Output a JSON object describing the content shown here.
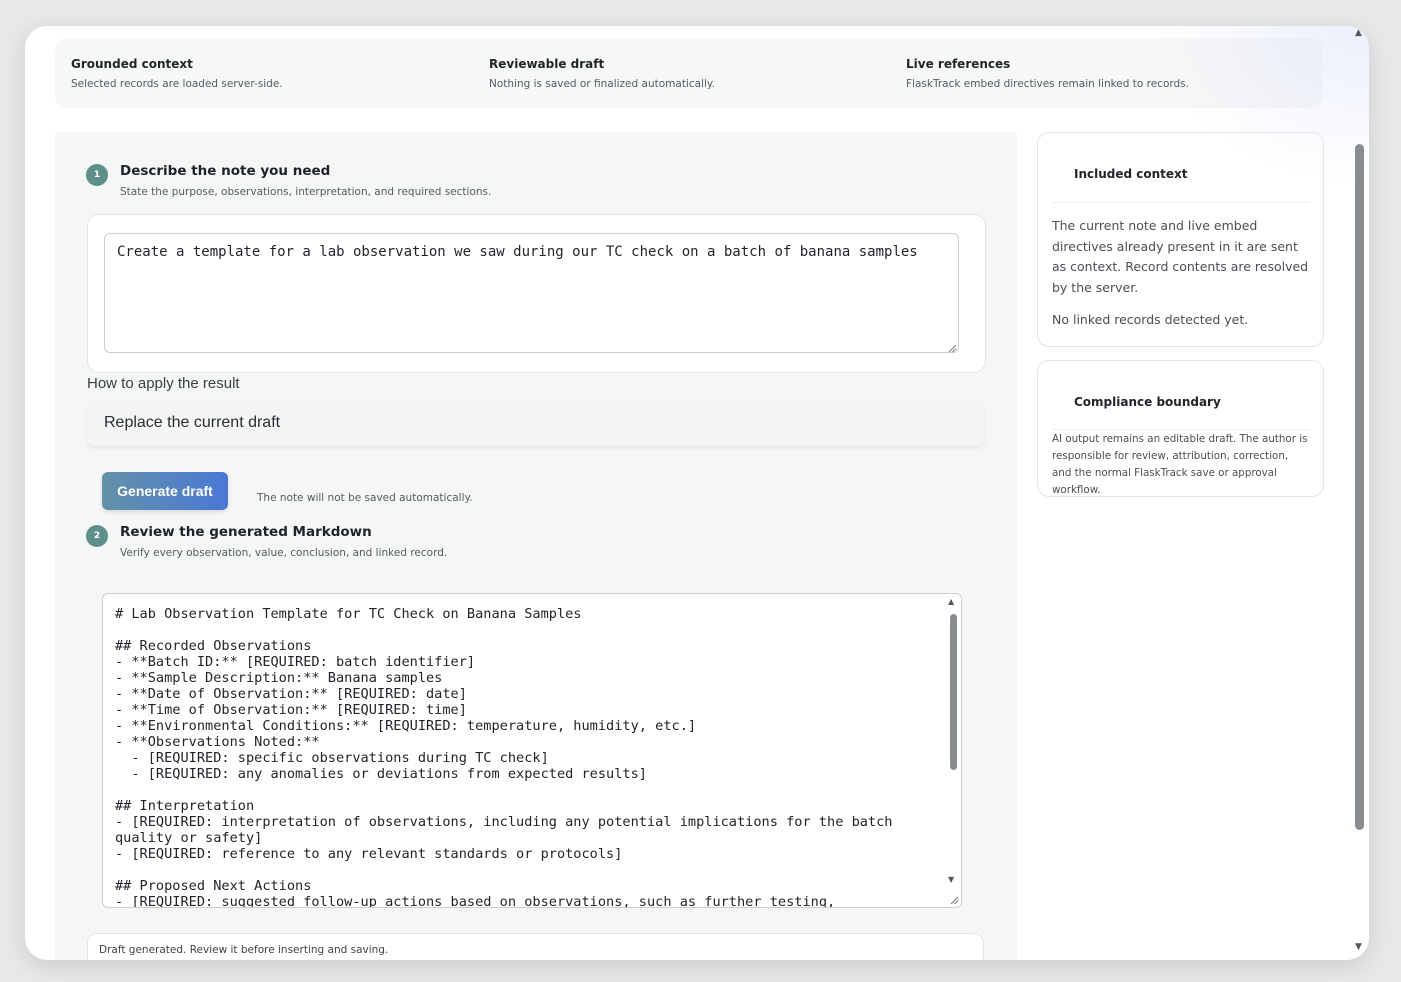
{
  "top_strip": [
    {
      "title": "Grounded context",
      "desc": "Selected records are loaded server-side."
    },
    {
      "title": "Reviewable draft",
      "desc": "Nothing is saved or finalized automatically."
    },
    {
      "title": "Live references",
      "desc": "FlaskTrack embed directives remain linked to records."
    }
  ],
  "step1": {
    "number": "1",
    "title": "Describe the note you need",
    "subtitle": "State the purpose, observations, interpretation, and required sections.",
    "prompt_value": "Create a template for a lab observation we saw during our TC check on a batch of banana samples"
  },
  "apply": {
    "label": "How to apply the result",
    "selected": "Replace the current draft"
  },
  "generate": {
    "button_label": "Generate draft",
    "note": "The note will not be saved automatically."
  },
  "step2": {
    "number": "2",
    "title": "Review the generated Markdown",
    "subtitle": "Verify every observation, value, conclusion, and linked record.",
    "output_lines": [
      "# Lab Observation Template for TC Check on Banana Samples",
      "",
      "## Recorded Observations",
      "- **Batch ID:** [REQUIRED: batch identifier]",
      "- **Sample Description:** Banana samples",
      "- **Date of Observation:** [REQUIRED: date]",
      "- **Time of Observation:** [REQUIRED: time]",
      "- **Environmental Conditions:** [REQUIRED: temperature, humidity, etc.]",
      "- **Observations Noted:**",
      "  - [REQUIRED: specific observations during TC check]",
      "  - [REQUIRED: any anomalies or deviations from expected results]",
      "",
      "## Interpretation",
      "- [REQUIRED: interpretation of observations, including any potential implications for the batch",
      "quality or safety]",
      "- [REQUIRED: reference to any relevant standards or protocols]",
      "",
      "## Proposed Next Actions",
      "- [REQUIRED: suggested follow-up actions based on observations, such as further testing,"
    ]
  },
  "status": "Draft generated. Review it before inserting and saving.",
  "included_context": {
    "title": "Included context",
    "body": "The current note and live embed directives already present in it are sent as context. Record contents are resolved by the server.",
    "empty": "No linked records detected yet."
  },
  "compliance": {
    "title": "Compliance boundary",
    "body": "AI output remains an editable draft. The author is responsible for review, attribution, correction, and the normal FlaskTrack save or approval workflow."
  },
  "colors": {
    "step_badge": "#5f8f8b",
    "button_start": "#6491a8",
    "button_end": "#4a78d6"
  }
}
